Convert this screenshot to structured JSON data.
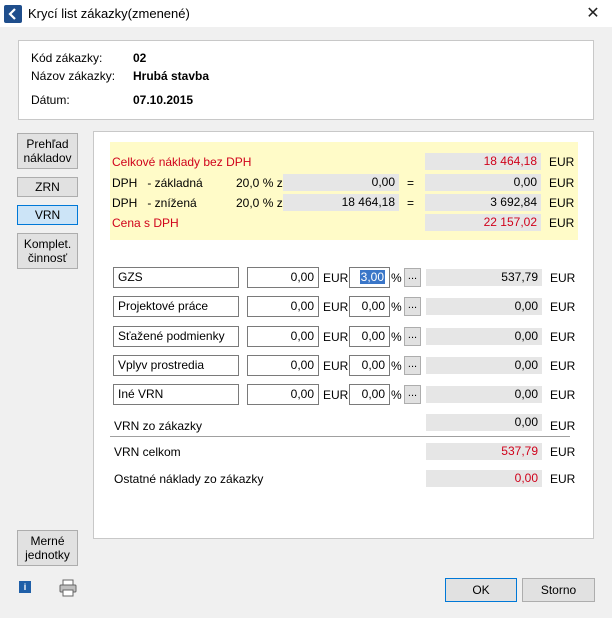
{
  "window": {
    "title": "Krycí list zákazky(zmenené)",
    "close_glyph": "✕"
  },
  "header": {
    "kod_label": "Kód zákazky:",
    "kod_value": "02",
    "nazov_label": "Názov zákazky:",
    "nazov_value": "Hrubá stavba",
    "datum_label": "Dátum:",
    "datum_value": "07.10.2015"
  },
  "sidebar": {
    "prehlad_line1": "Prehľad",
    "prehlad_line2": "nákladov",
    "zrn": "ZRN",
    "vrn": "VRN",
    "komplet_line1": "Komplet.",
    "komplet_line2": "činnosť",
    "merne_line1": "Merné",
    "merne_line2": "jednotky"
  },
  "summary": {
    "naklady_label": "Celkové náklady bez DPH",
    "naklady_value": "18 464,18",
    "dph_zakladna_label": "DPH   - základná",
    "dph_zakladna_rate": "20,0 % z",
    "dph_zakladna_base": "0,00",
    "dph_zakladna_value": "0,00",
    "dph_znizena_label": "DPH   - znížená",
    "dph_znizena_rate": "20,0 % z",
    "dph_znizena_base": "18 464,18",
    "dph_znizena_value": "3 692,84",
    "cena_label": "Cena s DPH",
    "cena_value": "22 157,02",
    "equals": "=",
    "currency": "EUR"
  },
  "vrn_rows": [
    {
      "name": "GZS",
      "amount": "0,00",
      "percent": "3,00",
      "total": "537,79"
    },
    {
      "name": "Projektové práce",
      "amount": "0,00",
      "percent": "0,00",
      "total": "0,00"
    },
    {
      "name": "Sťažené podmienky",
      "amount": "0,00",
      "percent": "0,00",
      "total": "0,00"
    },
    {
      "name": "Vplyv prostredia",
      "amount": "0,00",
      "percent": "0,00",
      "total": "0,00"
    },
    {
      "name": "Iné VRN",
      "amount": "0,00",
      "percent": "0,00",
      "total": "0,00"
    }
  ],
  "vrn_symbols": {
    "percent_sign": "%",
    "dots": "..."
  },
  "totals": {
    "vrn_zakazky_label": "VRN zo zákazky",
    "vrn_zakazky_value": "0,00",
    "vrn_celkom_label": "VRN celkom",
    "vrn_celkom_value": "537,79",
    "ostatne_label": "Ostatné náklady zo zákazky",
    "ostatne_value": "0,00"
  },
  "footer": {
    "ok": "OK",
    "storno": "Storno",
    "info_glyph": "i"
  },
  "colors": {
    "accent": "#0078d7",
    "red": "#d0021b",
    "yellow_bg": "#fffbc8"
  },
  "icons": [
    "back-arrow-icon",
    "close-icon",
    "info-icon",
    "printer-icon"
  ]
}
